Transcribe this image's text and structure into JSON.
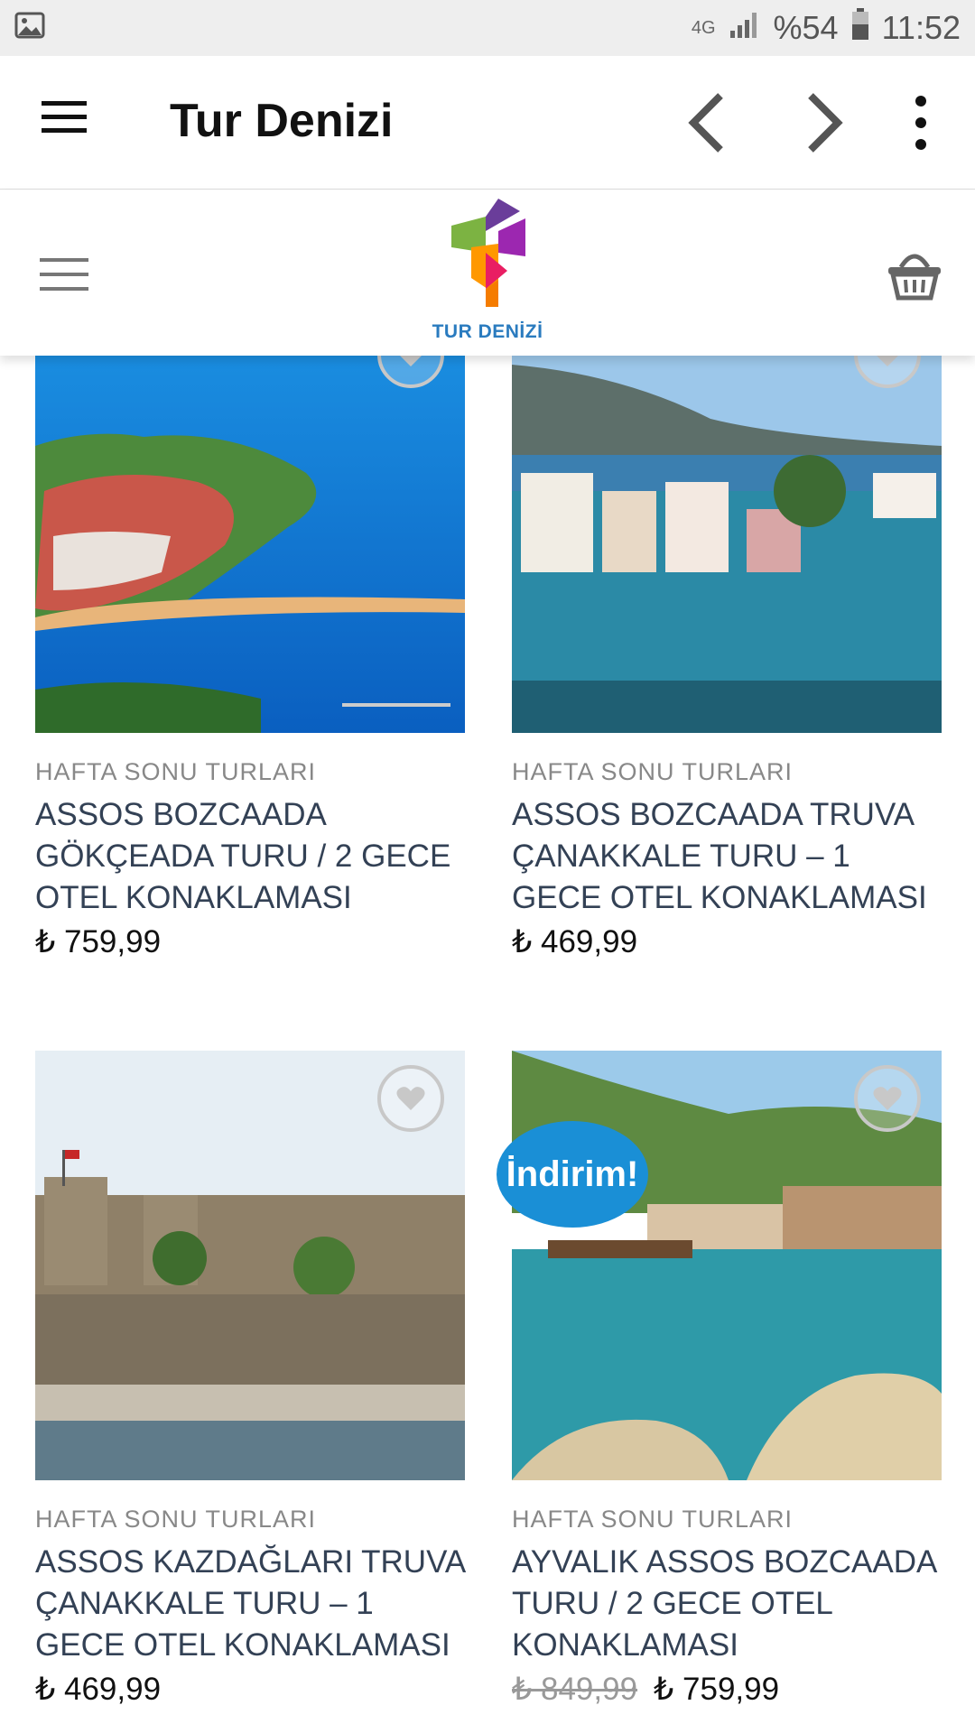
{
  "status_bar": {
    "network_top": "4G",
    "battery": "%54",
    "time": "11:52",
    "icons": [
      "image-icon",
      "signal-icon",
      "battery-icon"
    ]
  },
  "app_bar": {
    "title": "Tur Denizi",
    "icons": [
      "menu-icon",
      "chevron-left-icon",
      "chevron-right-icon",
      "more-vert-icon"
    ]
  },
  "site_header": {
    "logo_text": "TUR DENİZİ",
    "icons": [
      "hamburger-icon",
      "basket-icon"
    ]
  },
  "colors": {
    "badge_blue": "#1a8fd6",
    "logo_blue": "#2a7bbf",
    "title_text": "#334155"
  },
  "products": [
    {
      "category": "HAFTA SONU TURLARI",
      "name": "ASSOS BOZCAADA GÖKÇEADA TURU / 2 GECE OTEL KONAKLAMASI",
      "price": "₺ 759,99"
    },
    {
      "category": "HAFTA SONU TURLARI",
      "name": "ASSOS BOZCAADA TRUVA ÇANAKKALE TURU – 1 GECE OTEL KONAKLAMASI",
      "price": "₺ 469,99"
    },
    {
      "category": "HAFTA SONU TURLARI",
      "name": "ASSOS KAZDAĞLARI TRUVA ÇANAKKALE TURU – 1 GECE OTEL KONAKLAMASI",
      "price": "₺ 469,99"
    },
    {
      "category": "HAFTA SONU TURLARI",
      "name": "AYVALIK ASSOS BOZCAADA TURU / 2 GECE OTEL KONAKLAMASI",
      "old_price": "₺ 849,99",
      "price": "₺ 759,99",
      "badge": "İndirim!"
    }
  ]
}
